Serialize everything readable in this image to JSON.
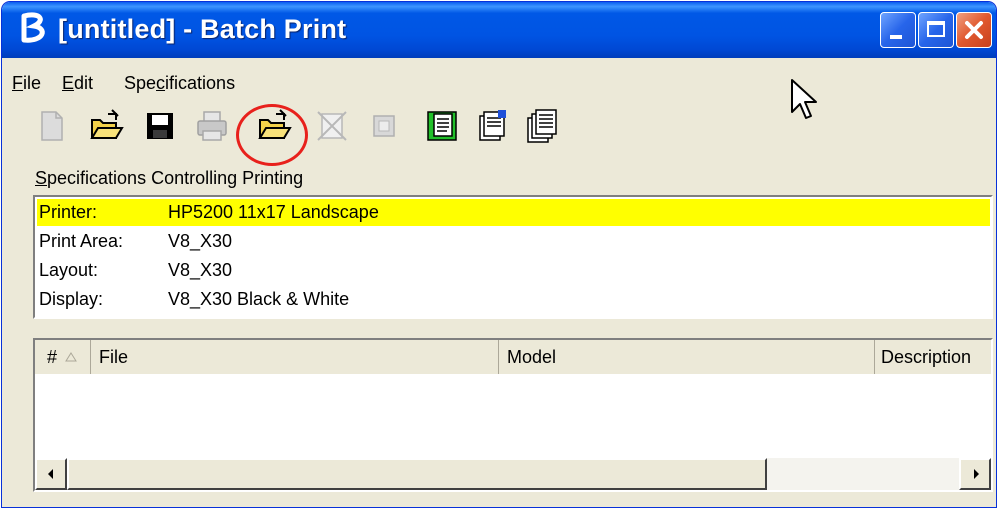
{
  "window": {
    "title": "[untitled] - Batch Print"
  },
  "menu": {
    "file": {
      "label": "File",
      "key": "F",
      "rest": "ile"
    },
    "edit": {
      "label": "Edit",
      "key": "E",
      "rest": "dit"
    },
    "specifications": {
      "label": "Specifications",
      "pre": "Spe",
      "key": "c",
      "rest": "ifications"
    }
  },
  "toolbar": {
    "icons": [
      "new-file-icon",
      "open-folder-icon",
      "save-disk-icon",
      "print-icon",
      "open-specification-icon",
      "remove-icon",
      "select-icon",
      "green-document-icon",
      "properties-icon",
      "document-list-icon"
    ]
  },
  "specifications": {
    "heading": "Specifications Controlling Printing",
    "heading_key": "S",
    "heading_rest": "pecifications Controlling Printing",
    "rows": [
      {
        "key": "Printer:",
        "value": "HP5200 11x17 Landscape",
        "selected": true
      },
      {
        "key": "Print Area:",
        "value": "V8_X30",
        "selected": false
      },
      {
        "key": "Layout:",
        "value": "V8_X30",
        "selected": false
      },
      {
        "key": "Display:",
        "value": "V8_X30 Black & White",
        "selected": false
      }
    ]
  },
  "file_list": {
    "columns": [
      "#",
      "File",
      "Model",
      "Description"
    ],
    "rows": []
  },
  "colors": {
    "selected_row": "#ffff00",
    "highlight_circle": "#e8211c",
    "titlebar": "#0054e3"
  }
}
